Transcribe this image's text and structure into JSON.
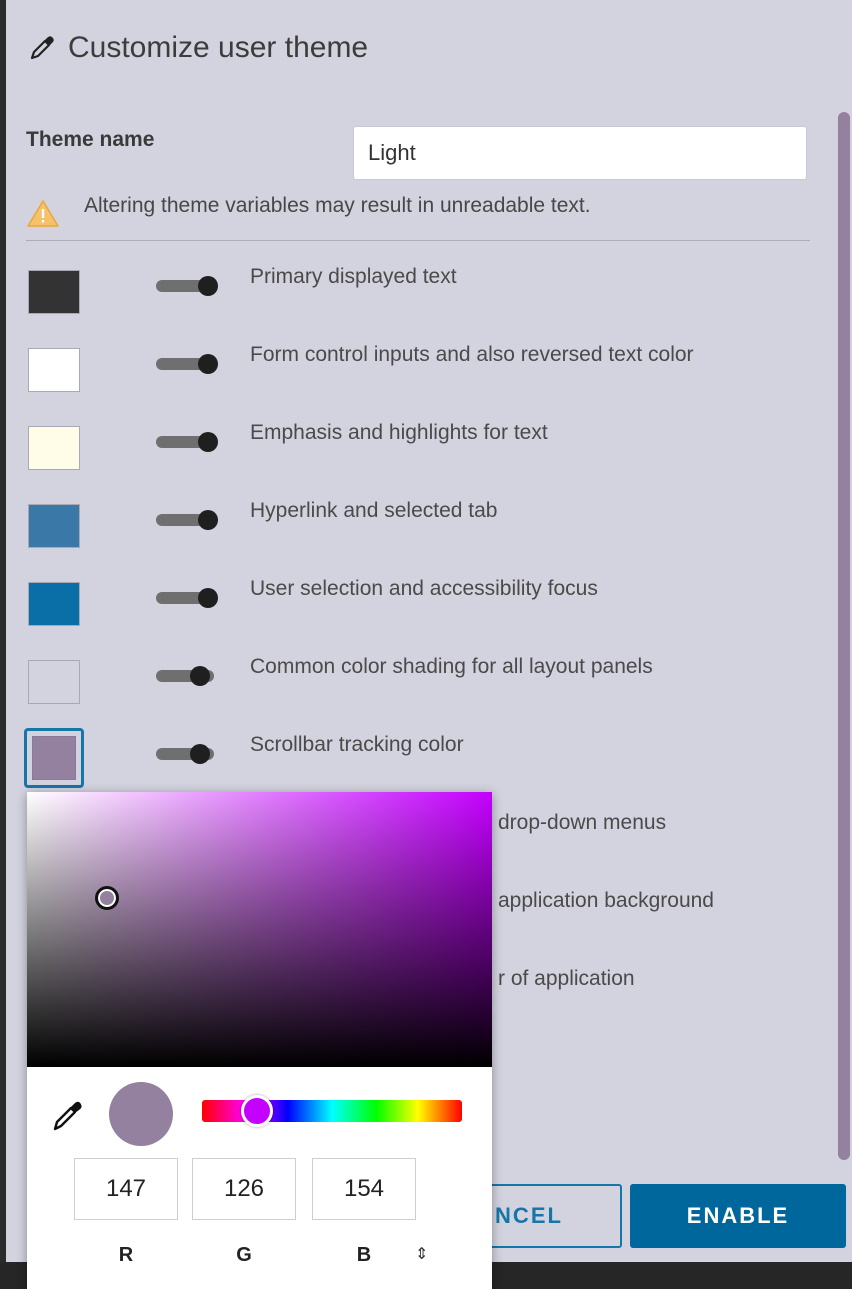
{
  "dialog": {
    "title": "Customize user theme",
    "theme_name_label": "Theme name",
    "theme_name_value": "Light",
    "warning": "Altering theme variables may result in unreadable text."
  },
  "variables": [
    {
      "label": "Primary displayed text",
      "color": "#333333",
      "toggle": "on"
    },
    {
      "label": "Form control inputs and also reversed text color",
      "color": "#ffffff",
      "toggle": "on"
    },
    {
      "label": "Emphasis and highlights for text",
      "color": "#fffde8",
      "toggle": "on"
    },
    {
      "label": "Hyperlink and selected tab",
      "color": "#3a78a8",
      "toggle": "on"
    },
    {
      "label": "User selection and accessibility focus",
      "color": "#0a6fa6",
      "toggle": "on"
    },
    {
      "label": "Common color shading for all layout panels",
      "color": "#d3d3df",
      "toggle": "mid"
    },
    {
      "label": "Scrollbar tracking color",
      "color": "#93819f",
      "toggle": "mid",
      "selected": true
    },
    {
      "label": "drop-down menus"
    },
    {
      "label": "application background"
    },
    {
      "label": "r of application"
    }
  ],
  "buttons": {
    "cancel": "NCEL",
    "enable": "ENABLE"
  },
  "color_picker": {
    "hue_color": "#c400ff",
    "current_color": "#93819f",
    "r": "147",
    "g": "126",
    "b": "154",
    "r_label": "R",
    "g_label": "G",
    "b_label": "B",
    "mode_switch": "⇕"
  },
  "colors": {
    "panel": "#d3d3df",
    "accent": "#00679d",
    "scrollbar": "#93819f"
  }
}
